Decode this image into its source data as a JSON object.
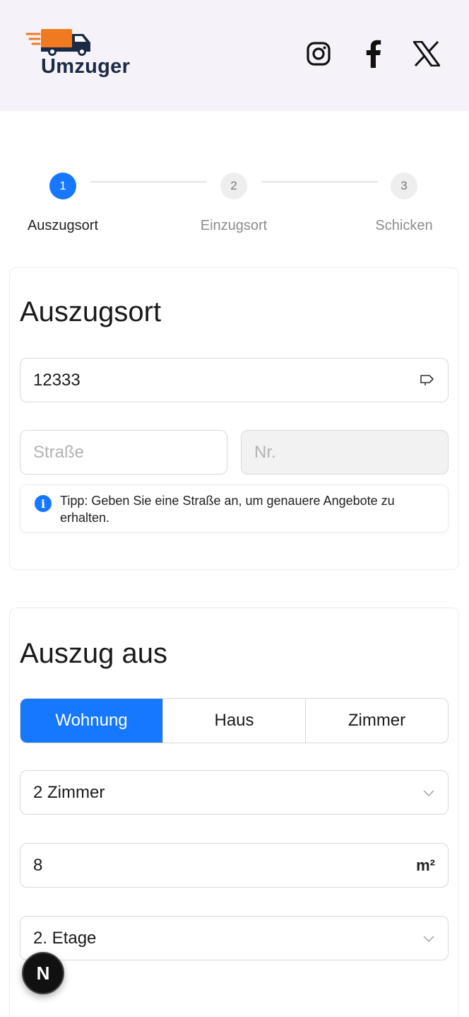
{
  "header": {
    "logo_text": "Umzuger",
    "social": [
      {
        "icon": "instagram-icon"
      },
      {
        "icon": "facebook-icon"
      },
      {
        "icon": "x-icon"
      }
    ]
  },
  "stepper": {
    "steps": [
      {
        "number": "1",
        "label": "Auszugsort",
        "state": "active"
      },
      {
        "number": "2",
        "label": "Einzugsort",
        "state": "inactive"
      },
      {
        "number": "3",
        "label": "Schicken",
        "state": "inactive"
      }
    ]
  },
  "moveout_place": {
    "title": "Auszugsort",
    "zip_value": "12333",
    "zip_suffix_icon": "signpost-icon",
    "street_placeholder": "Straße",
    "number_placeholder": "Nr.",
    "tip_text": "Tipp: Geben Sie eine Straße an, um genauere Angebote zu erhalten."
  },
  "moveout_from": {
    "title": "Auszug aus",
    "types": [
      "Wohnung",
      "Haus",
      "Zimmer"
    ],
    "selected_type": "Wohnung",
    "rooms_value": "2 Zimmer",
    "area_value": "8",
    "area_unit": "m²",
    "floor_value": "2. Etage"
  },
  "fab": {
    "label": "N"
  },
  "colors": {
    "accent": "#1677ff",
    "header_bg": "#f6f2f9"
  }
}
